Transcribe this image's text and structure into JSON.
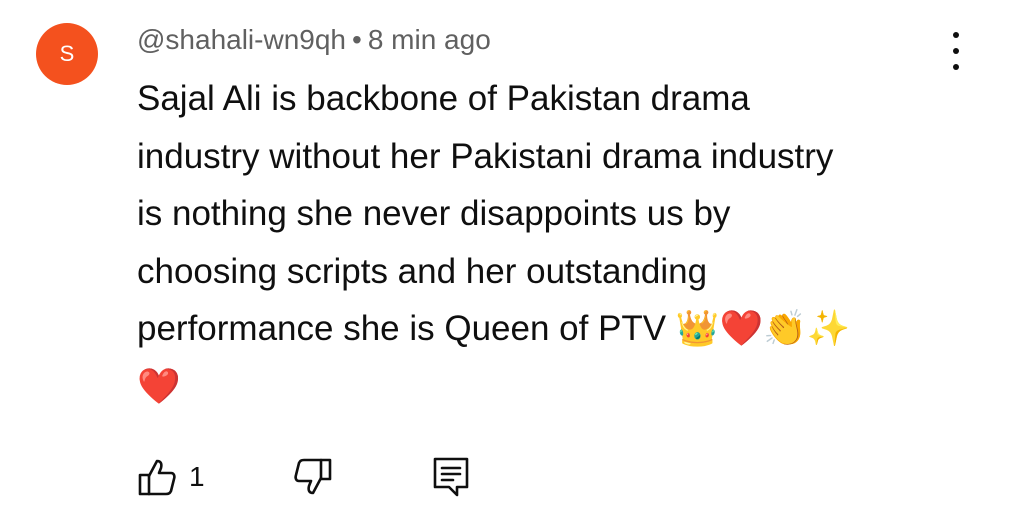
{
  "comment": {
    "avatar_letter": "S",
    "avatar_color": "#f4511e",
    "author": "@shahali-wn9qh",
    "separator": "•",
    "timestamp": "8 min ago",
    "text": "Sajal Ali is backbone of Pakistan drama\nindustry without her Pakistani drama industry\nis nothing she never disappoints us by\nchoosing scripts and her outstanding\nperformance she is Queen of PTV 👑❤️👏✨\n❤️",
    "more_icon": "more-vertical-icon"
  },
  "actions": {
    "like_icon": "thumbs-up-icon",
    "like_count": "1",
    "dislike_icon": "thumbs-down-icon",
    "reply_icon": "reply-comment-icon"
  }
}
